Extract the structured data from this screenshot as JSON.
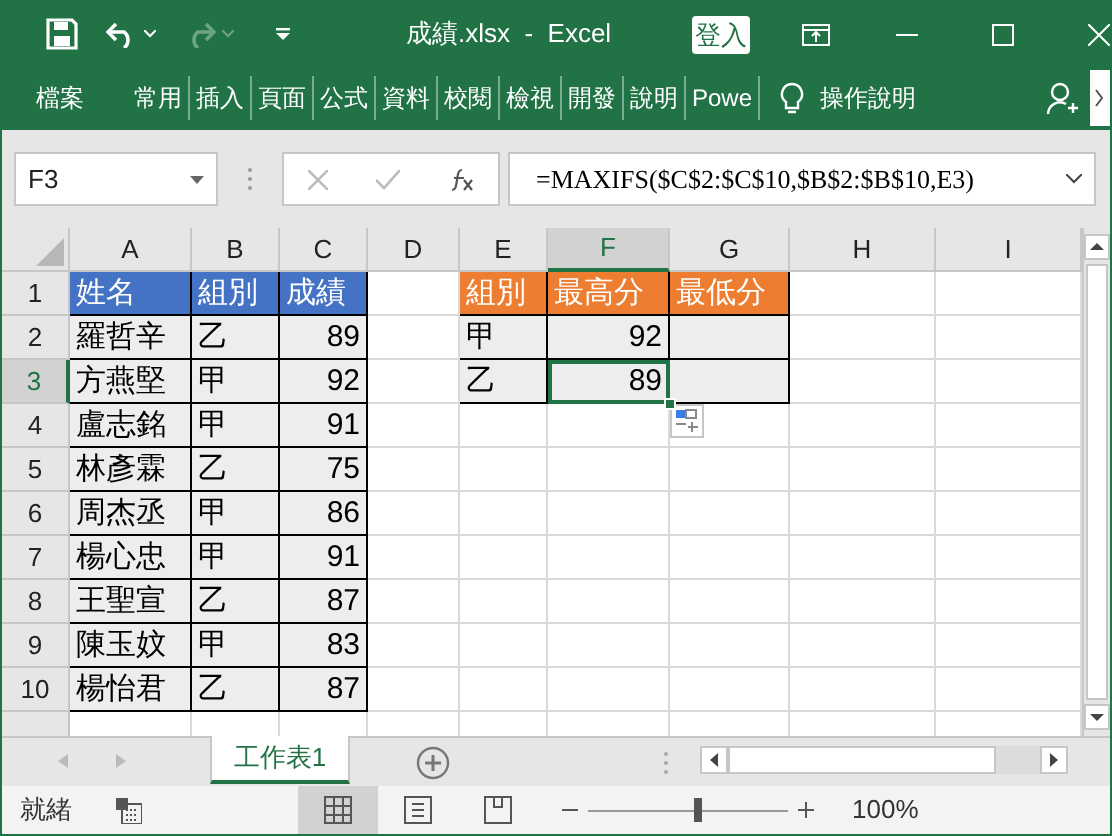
{
  "title_bar": {
    "document_title": "成績.xlsx  -  Excel",
    "sign_in": "登入",
    "redo_disabled": true
  },
  "ribbon_tabs": [
    {
      "label": "檔案"
    },
    {
      "label": "常用"
    },
    {
      "label": "插入"
    },
    {
      "label": "頁面"
    },
    {
      "label": "公式"
    },
    {
      "label": "資料"
    },
    {
      "label": "校閱"
    },
    {
      "label": "檢視"
    },
    {
      "label": "開發"
    },
    {
      "label": "說明"
    },
    {
      "label": "Powe"
    }
  ],
  "tell_me": "操作說明",
  "formula_bar": {
    "name_box": "F3",
    "formula": "=MAXIFS($C$2:$C$10,$B$2:$B$10,E3)"
  },
  "columns": [
    {
      "label": "A",
      "selected": false
    },
    {
      "label": "B",
      "selected": false
    },
    {
      "label": "C",
      "selected": false
    },
    {
      "label": "D",
      "selected": false
    },
    {
      "label": "E",
      "selected": false
    },
    {
      "label": "F",
      "selected": true
    },
    {
      "label": "G",
      "selected": false
    },
    {
      "label": "H",
      "selected": false
    },
    {
      "label": "I",
      "selected": false
    }
  ],
  "rows": [
    {
      "number": "1",
      "selected": false,
      "cells": [
        {
          "kind": "header",
          "text": "姓名",
          "color": "#4472c4"
        },
        {
          "kind": "header",
          "text": "組別",
          "color": "#4472c4"
        },
        {
          "kind": "header",
          "text": "成績",
          "color": "#4472c4"
        },
        {
          "kind": "empty"
        },
        {
          "kind": "header",
          "text": "組別",
          "color": "#ed7d31"
        },
        {
          "kind": "header",
          "text": "最高分",
          "color": "#ed7d31"
        },
        {
          "kind": "header",
          "text": "最低分",
          "color": "#ed7d31"
        },
        {
          "kind": "empty"
        },
        {
          "kind": "empty"
        }
      ]
    },
    {
      "number": "2",
      "selected": false,
      "cells": [
        {
          "kind": "text",
          "text": "羅哲辛"
        },
        {
          "kind": "text",
          "text": "乙"
        },
        {
          "kind": "number",
          "text": "89"
        },
        {
          "kind": "empty"
        },
        {
          "kind": "text",
          "text": "甲"
        },
        {
          "kind": "number",
          "text": "92"
        },
        {
          "kind": "blank"
        },
        {
          "kind": "empty"
        },
        {
          "kind": "empty"
        }
      ]
    },
    {
      "number": "3",
      "selected": true,
      "cells": [
        {
          "kind": "text",
          "text": "方燕堅"
        },
        {
          "kind": "text",
          "text": "甲"
        },
        {
          "kind": "number",
          "text": "92"
        },
        {
          "kind": "empty"
        },
        {
          "kind": "text",
          "text": "乙"
        },
        {
          "kind": "number",
          "text": "89",
          "selected": true
        },
        {
          "kind": "blank"
        },
        {
          "kind": "empty"
        },
        {
          "kind": "empty"
        }
      ]
    },
    {
      "number": "4",
      "selected": false,
      "cells": [
        {
          "kind": "text",
          "text": "盧志銘"
        },
        {
          "kind": "text",
          "text": "甲"
        },
        {
          "kind": "number",
          "text": "91"
        },
        {
          "kind": "empty"
        },
        {
          "kind": "empty"
        },
        {
          "kind": "empty"
        },
        {
          "kind": "empty"
        },
        {
          "kind": "empty"
        },
        {
          "kind": "empty"
        }
      ]
    },
    {
      "number": "5",
      "selected": false,
      "cells": [
        {
          "kind": "text",
          "text": "林彥霖"
        },
        {
          "kind": "text",
          "text": "乙"
        },
        {
          "kind": "number",
          "text": "75"
        },
        {
          "kind": "empty"
        },
        {
          "kind": "empty"
        },
        {
          "kind": "empty"
        },
        {
          "kind": "empty"
        },
        {
          "kind": "empty"
        },
        {
          "kind": "empty"
        }
      ]
    },
    {
      "number": "6",
      "selected": false,
      "cells": [
        {
          "kind": "text",
          "text": "周杰丞"
        },
        {
          "kind": "text",
          "text": "甲"
        },
        {
          "kind": "number",
          "text": "86"
        },
        {
          "kind": "empty"
        },
        {
          "kind": "empty"
        },
        {
          "kind": "empty"
        },
        {
          "kind": "empty"
        },
        {
          "kind": "empty"
        },
        {
          "kind": "empty"
        }
      ]
    },
    {
      "number": "7",
      "selected": false,
      "cells": [
        {
          "kind": "text",
          "text": "楊心忠"
        },
        {
          "kind": "text",
          "text": "甲"
        },
        {
          "kind": "number",
          "text": "91"
        },
        {
          "kind": "empty"
        },
        {
          "kind": "empty"
        },
        {
          "kind": "empty"
        },
        {
          "kind": "empty"
        },
        {
          "kind": "empty"
        },
        {
          "kind": "empty"
        }
      ]
    },
    {
      "number": "8",
      "selected": false,
      "cells": [
        {
          "kind": "text",
          "text": "王聖宣"
        },
        {
          "kind": "text",
          "text": "乙"
        },
        {
          "kind": "number",
          "text": "87"
        },
        {
          "kind": "empty"
        },
        {
          "kind": "empty"
        },
        {
          "kind": "empty"
        },
        {
          "kind": "empty"
        },
        {
          "kind": "empty"
        },
        {
          "kind": "empty"
        }
      ]
    },
    {
      "number": "9",
      "selected": false,
      "cells": [
        {
          "kind": "text",
          "text": "陳玉妏"
        },
        {
          "kind": "text",
          "text": "甲"
        },
        {
          "kind": "number",
          "text": "83"
        },
        {
          "kind": "empty"
        },
        {
          "kind": "empty"
        },
        {
          "kind": "empty"
        },
        {
          "kind": "empty"
        },
        {
          "kind": "empty"
        },
        {
          "kind": "empty"
        }
      ]
    },
    {
      "number": "10",
      "selected": false,
      "cells": [
        {
          "kind": "text",
          "text": "楊怡君"
        },
        {
          "kind": "text",
          "text": "乙"
        },
        {
          "kind": "number",
          "text": "87"
        },
        {
          "kind": "empty"
        },
        {
          "kind": "empty"
        },
        {
          "kind": "empty"
        },
        {
          "kind": "empty"
        },
        {
          "kind": "empty"
        },
        {
          "kind": "empty"
        }
      ]
    }
  ],
  "sheet_tabs": [
    {
      "label": "工作表1",
      "selected": true
    }
  ],
  "status_bar": {
    "status": "就緒",
    "views": [
      {
        "kind": "normal",
        "selected": true
      },
      {
        "kind": "page-layout",
        "selected": false
      },
      {
        "kind": "page-break",
        "selected": false
      }
    ],
    "zoom": {
      "level": 0.55,
      "reading": "100%"
    }
  }
}
